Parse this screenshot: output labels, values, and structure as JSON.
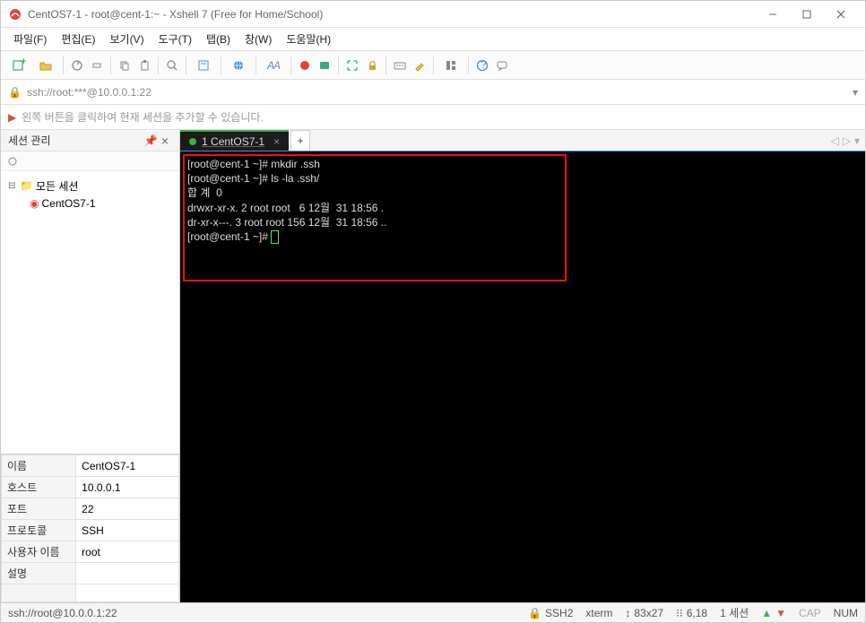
{
  "window": {
    "title": "CentOS7-1 - root@cent-1:~ - Xshell 7 (Free for Home/School)"
  },
  "menu": {
    "file": "파일(F)",
    "edit": "편집(E)",
    "view": "보기(V)",
    "tools": "도구(T)",
    "tab": "탭(B)",
    "window": "창(W)",
    "help": "도움말(H)"
  },
  "address": "ssh://root:***@10.0.0.1:22",
  "hint": "왼쪽 버튼을 클릭하여 현재 세션을 추가할 수 있습니다.",
  "sessions_panel": {
    "title": "세션 관리",
    "root": "모든 세션",
    "item": "CentOS7-1"
  },
  "properties": {
    "name_k": "이름",
    "name_v": "CentOS7-1",
    "host_k": "호스트",
    "host_v": "10.0.0.1",
    "port_k": "포트",
    "port_v": "22",
    "proto_k": "프로토콜",
    "proto_v": "SSH",
    "user_k": "사용자 이름",
    "user_v": "root",
    "desc_k": "설명",
    "desc_v": ""
  },
  "tab": {
    "index": "1",
    "label": "CentOS7-1"
  },
  "terminal": {
    "l1": "[root@cent-1 ~]# mkdir .ssh",
    "l2": "[root@cent-1 ~]# ls -la .ssh/",
    "l3": "합 계  0",
    "l4": "drwxr-xr-x. 2 root root   6 12월  31 18:56 .",
    "l5": "dr-xr-x---. 3 root root 156 12월  31 18:56 ..",
    "l6": "[root@cent-1 ~]# "
  },
  "status": {
    "connection": "ssh://root@10.0.0.1:22",
    "proto": "SSH2",
    "term": "xterm",
    "size": "83x27",
    "cursor": "6,18",
    "sessions": "1 세션",
    "cap": "CAP",
    "num": "NUM"
  }
}
